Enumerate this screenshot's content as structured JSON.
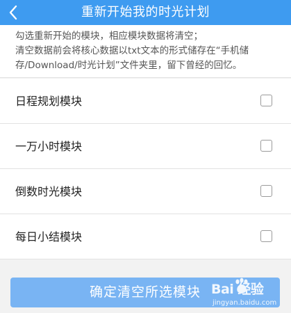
{
  "header": {
    "title": "重新开始我的时光计划",
    "back_icon": "back-arrow-icon"
  },
  "notice": {
    "line1": "勾选重新开始的模块，相应模块数据将清空；",
    "line2": "清空数据前会将核心数据以txt文本的形式储存在“手机储",
    "line3": "存/Download/时光计划”文件夹里，留下曾经的回忆。"
  },
  "modules": [
    {
      "label": "日程规划模块",
      "checked": false
    },
    {
      "label": "一万小时模块",
      "checked": false
    },
    {
      "label": "倒数时光模块",
      "checked": false
    },
    {
      "label": "每日小结模块",
      "checked": false
    }
  ],
  "confirm_button": {
    "label": "确定清空所选模块"
  },
  "watermark": {
    "logo": "Bai 经验",
    "site": "jingyan.baidu.com"
  },
  "colors": {
    "header": "#3e9bf0",
    "button": "#79b4f3",
    "background": "#f2f2f2"
  }
}
